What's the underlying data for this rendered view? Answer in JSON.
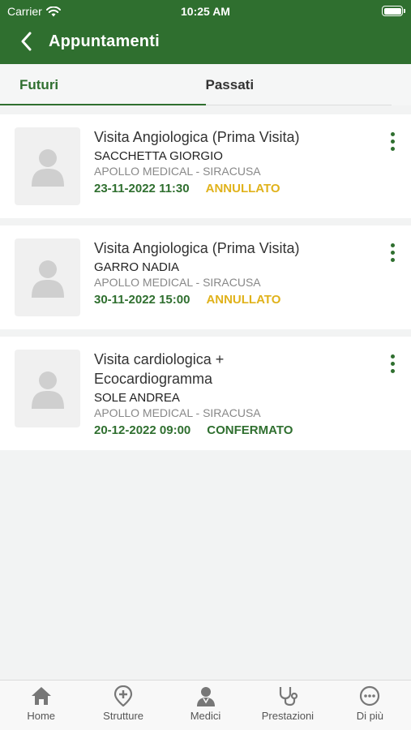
{
  "status": {
    "carrier": "Carrier",
    "time": "10:25 AM"
  },
  "header": {
    "title": "Appuntamenti"
  },
  "tabs": [
    {
      "label": "Futuri",
      "active": true
    },
    {
      "label": "Passati",
      "active": false
    }
  ],
  "appointments": [
    {
      "service": "Visita Angiologica (Prima Visita)",
      "doctor": "SACCHETTA GIORGIO",
      "place": "APOLLO MEDICAL - SIRACUSA",
      "datetime": "23-11-2022 11:30",
      "status": "ANNULLATO"
    },
    {
      "service": "Visita Angiologica (Prima Visita)",
      "doctor": "GARRO NADIA",
      "place": "APOLLO MEDICAL - SIRACUSA",
      "datetime": "30-11-2022 15:00",
      "status": "ANNULLATO"
    },
    {
      "service": "Visita cardiologica + Ecocardiogramma",
      "doctor": "SOLE ANDREA",
      "place": "APOLLO MEDICAL - SIRACUSA",
      "datetime": "20-12-2022 09:00",
      "status": "CONFERMATO"
    }
  ],
  "bottom_nav": [
    {
      "label": "Home",
      "icon": "home-icon"
    },
    {
      "label": "Strutture",
      "icon": "location-pin-icon"
    },
    {
      "label": "Medici",
      "icon": "doctor-icon"
    },
    {
      "label": "Prestazioni",
      "icon": "stethoscope-icon"
    },
    {
      "label": "Di più",
      "icon": "more-circle-icon"
    }
  ],
  "colors": {
    "primary": "#2f6f2f",
    "cancelled": "#e0b21b",
    "confirmed": "#2f6f2f"
  }
}
